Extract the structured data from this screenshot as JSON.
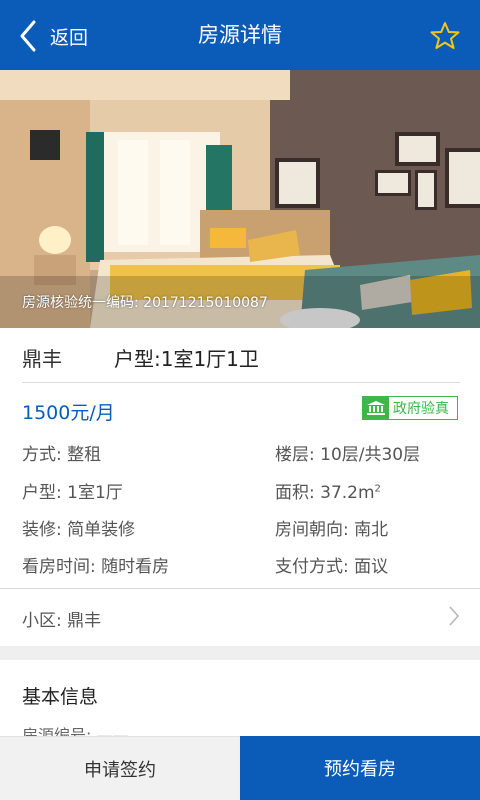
{
  "header": {
    "back_label": "返回",
    "title": "房源详情",
    "back_icon": "chevron-left-icon",
    "favorite_icon": "star-icon",
    "color": "#0b5cb8",
    "star_color": "#f5c518"
  },
  "photo": {
    "verification_code": "房源核验统一编码: 20171215010087"
  },
  "summary": {
    "community": "鼎丰",
    "house_type": "户型:1室1厅1卫",
    "price": "1500元/月",
    "gov_badge": "政府验真",
    "gov_badge_icon": "government-building-icon",
    "accent_color": "#0b5cb8",
    "badge_color": "#3db64a"
  },
  "attributes": {
    "mode": "方式: 整租",
    "floor": "楼层: 10层/共30层",
    "layout": "户型: 1室1厅",
    "area": "面积: 37.2m",
    "area_unit_sup": "2",
    "decoration": "装修: 简单装修",
    "orientation": "房间朝向: 南北",
    "viewing": "看房时间: 随时看房",
    "payment": "支付方式: 面议"
  },
  "community_row": {
    "label": "小区: 鼎丰",
    "icon": "chevron-right-icon"
  },
  "basic_info": {
    "title": "基本信息",
    "partial_line": "房源编号: ——"
  },
  "actions": {
    "apply_sign": "申请签约",
    "book_viewing": "预约看房"
  }
}
